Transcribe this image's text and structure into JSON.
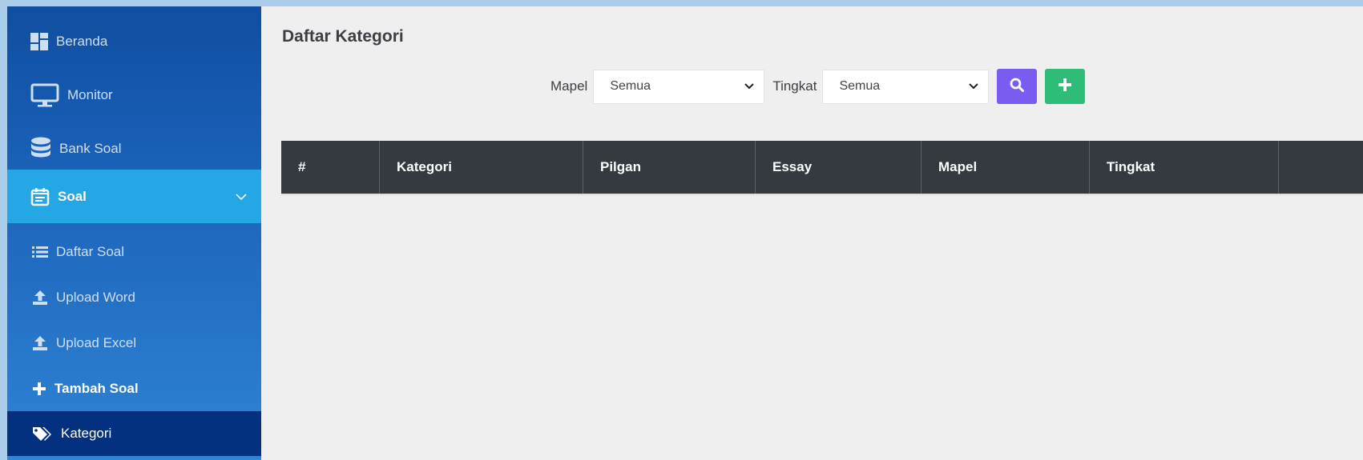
{
  "sidebar": {
    "items": [
      {
        "label": "Beranda",
        "icon": "dashboard-icon"
      },
      {
        "label": "Monitor",
        "icon": "monitor-icon"
      },
      {
        "label": "Bank Soal",
        "icon": "database-icon"
      },
      {
        "label": "Soal",
        "icon": "calendar-list-icon"
      },
      {
        "label": "Daftar Soal",
        "icon": "list-icon"
      },
      {
        "label": "Upload Word",
        "icon": "upload-icon"
      },
      {
        "label": "Upload Excel",
        "icon": "upload-icon"
      },
      {
        "label": "Tambah Soal",
        "icon": "plus-icon"
      },
      {
        "label": "Kategori",
        "icon": "tags-icon"
      }
    ]
  },
  "main": {
    "title": "Daftar Kategori",
    "filters": {
      "mapel_label": "Mapel",
      "mapel_value": "Semua",
      "tingkat_label": "Tingkat",
      "tingkat_value": "Semua"
    },
    "table": {
      "headers": [
        "#",
        "Kategori",
        "Pilgan",
        "Essay",
        "Mapel",
        "Tingkat",
        ""
      ]
    }
  },
  "colors": {
    "sidebar_active": "#25a6e5",
    "sidebar_current": "#03307f",
    "search_button": "#7a5cf0",
    "add_button": "#2dbd78",
    "table_header": "#343a40"
  }
}
